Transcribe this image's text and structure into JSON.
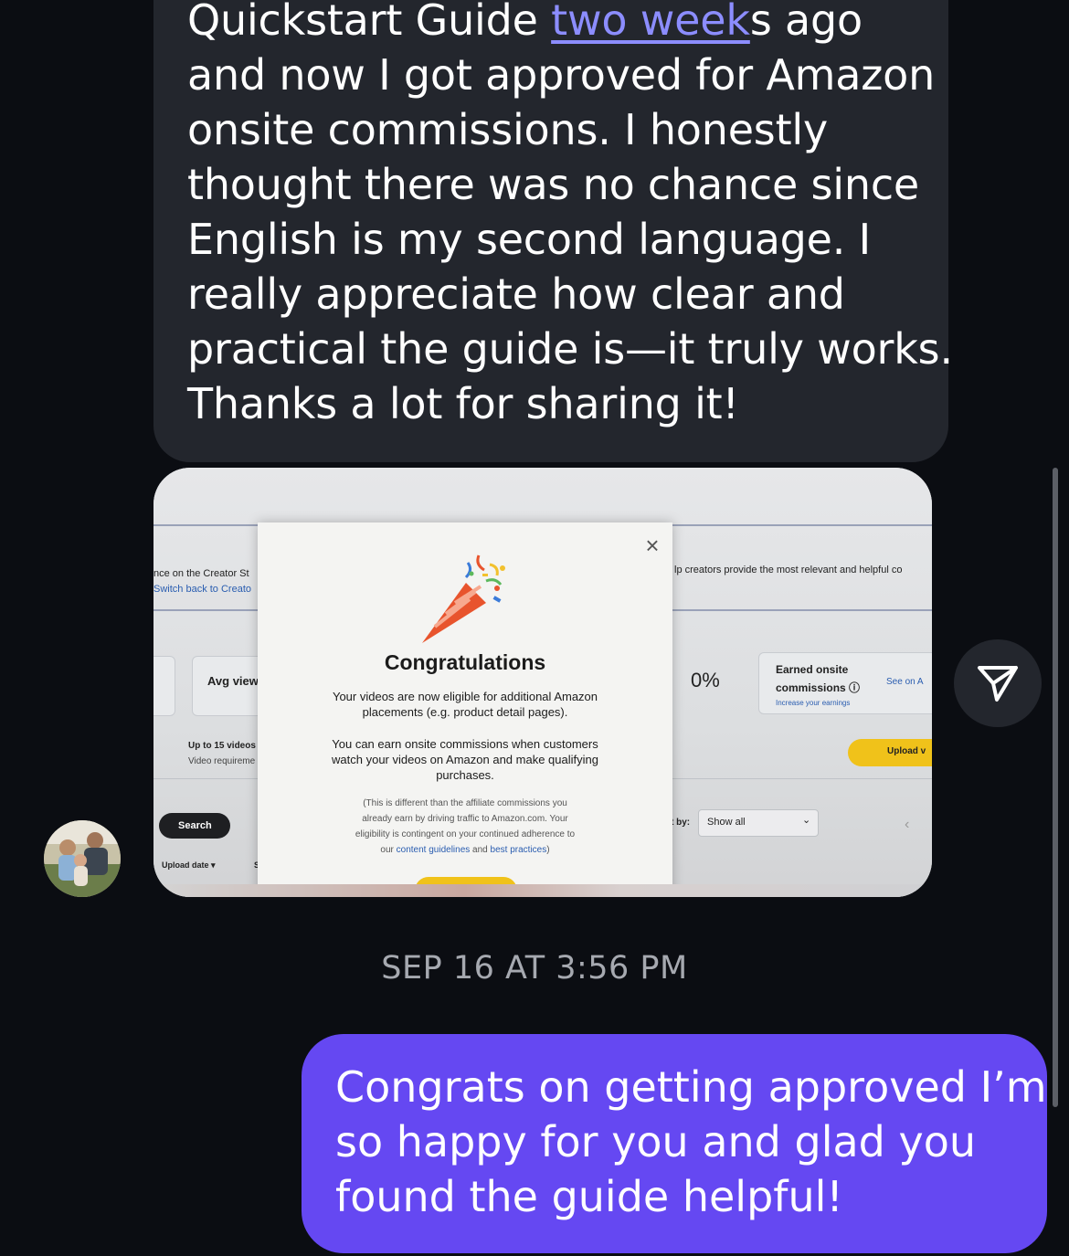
{
  "thread": {
    "incoming_message": {
      "lines": [
        {
          "before": "Quickstart Guide ",
          "link": "two week",
          "after": "s ago"
        },
        {
          "text": "and now I got approved for Amazon"
        },
        {
          "text": "onsite commissions. I honestly"
        },
        {
          "text": "thought there was no chance since"
        },
        {
          "text": "English is my second language. I"
        },
        {
          "text": "really appreciate how clear and"
        },
        {
          "text": "practical the guide is—it truly works."
        },
        {
          "text": "Thanks a lot for sharing it!"
        }
      ]
    },
    "photo": {
      "left_text_1": "nce on the Creator St",
      "left_text_2": "Switch back to Creato",
      "avg_views": "Avg view",
      "up_to_videos": "Up to 15 videos",
      "video_requirements": "Video requireme",
      "search_button": "Search",
      "upload_date": "Upload date",
      "st": "St",
      "right_header": "lp creators provide the most relevant and helpful co",
      "zero_percent": "0%",
      "earned_onsite": "Earned onsite",
      "commissions": "commissions",
      "increase_earnings": "Increase your earnings",
      "see_on": "See on A",
      "upload_button": "Upload v",
      "sort_by": "t by:",
      "show_all": "Show all",
      "modal": {
        "title": "Congratulations",
        "para1_line1": "Your videos are now eligible for additional Amazon",
        "para1_line2": "placements (e.g. product detail pages).",
        "para2_line1": "You can earn onsite commissions when customers",
        "para2_line2": "watch your videos on Amazon and make qualifying",
        "para2_line3": "purchases.",
        "note_line1": "(This is different than the affiliate commissions you",
        "note_line2": "already earn by driving traffic to Amazon.com. Your",
        "note_line3": "eligibility is contingent on your continued adherence to",
        "note_line4_prefix": "our ",
        "note_link1": "content guidelines",
        "note_mid": " and ",
        "note_link2": "best practices",
        "note_suffix": ")",
        "close_icon": "×"
      }
    },
    "timestamp": "SEP 16 AT 3:56 PM",
    "outgoing_message": {
      "lines": [
        "Congrats on getting approved I’m",
        "so happy for you and glad you",
        "found the guide helpful!"
      ]
    }
  },
  "icons": {
    "share": "paper-plane-icon",
    "avatar": "user-avatar"
  },
  "colors": {
    "background": "#0b0d12",
    "incoming_bubble": "#23262d",
    "outgoing_bubble": "#6548f2",
    "link": "#8c8dff",
    "timestamp": "#a6a9b0"
  }
}
